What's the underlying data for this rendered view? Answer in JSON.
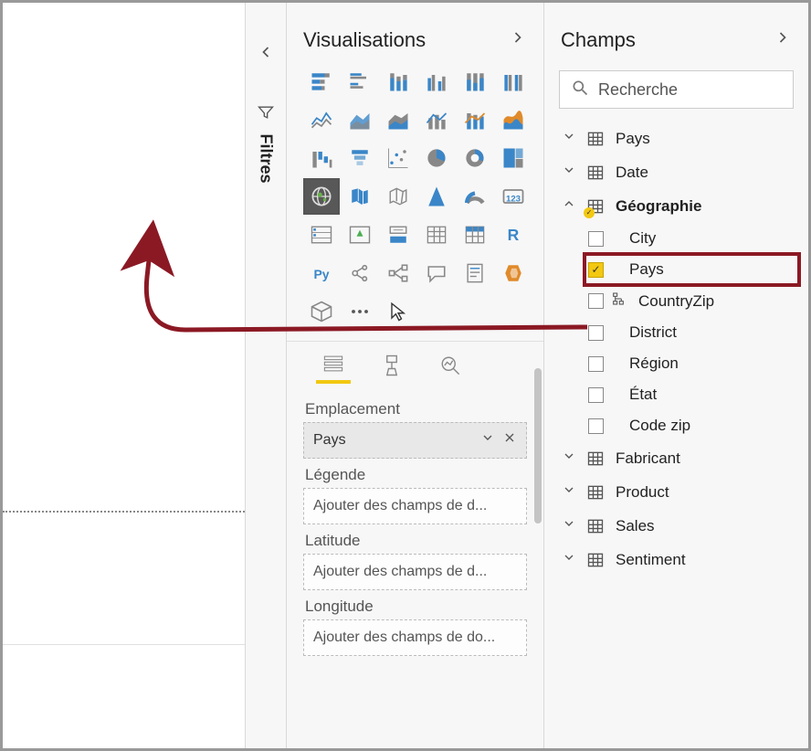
{
  "filters": {
    "label": "Filtres"
  },
  "viz": {
    "title": "Visualisations",
    "icons": [
      "stacked-bar",
      "clustered-bar",
      "stacked-column",
      "clustered-column",
      "stacked-column-100",
      "clustered-column-100",
      "line",
      "area",
      "stacked-area",
      "line-clustered",
      "line-stacked",
      "ribbon",
      "waterfall",
      "funnel",
      "scatter",
      "pie",
      "donut",
      "treemap",
      "map",
      "filled-map",
      "shape-map",
      "arcgis",
      "gauge",
      "card",
      "multi-row-card",
      "kpi",
      "slicer",
      "table",
      "matrix",
      "r-visual",
      "python-visual",
      "key-influencers",
      "decomposition-tree",
      "qa",
      "paginated",
      "power-apps",
      "custom-visual",
      "more",
      "cursor"
    ],
    "wells": {
      "emplacement_label": "Emplacement",
      "emplacement_value": "Pays",
      "legende_label": "Légende",
      "legende_placeholder": "Ajouter des champs de d...",
      "latitude_label": "Latitude",
      "latitude_placeholder": "Ajouter des champs de d...",
      "longitude_label": "Longitude",
      "longitude_placeholder": "Ajouter des champs de do..."
    }
  },
  "fields": {
    "title": "Champs",
    "search_placeholder": "Recherche",
    "tables": [
      {
        "name": "Pays",
        "expanded": false
      },
      {
        "name": "Date",
        "expanded": false
      },
      {
        "name": "Géographie",
        "expanded": true,
        "has_selection": true,
        "fields": [
          {
            "name": "City",
            "checked": false
          },
          {
            "name": "Pays",
            "checked": true,
            "highlight": true
          },
          {
            "name": "CountryZip",
            "checked": false,
            "hier": true
          },
          {
            "name": "District",
            "checked": false
          },
          {
            "name": "Région",
            "checked": false
          },
          {
            "name": "État",
            "checked": false
          },
          {
            "name": "Code zip",
            "checked": false
          }
        ]
      },
      {
        "name": "Fabricant",
        "expanded": false
      },
      {
        "name": "Product",
        "expanded": false
      },
      {
        "name": "Sales",
        "expanded": false
      },
      {
        "name": "Sentiment",
        "expanded": false
      }
    ]
  },
  "colors": {
    "accent": "#f2c811",
    "annotation": "#8b1924"
  }
}
